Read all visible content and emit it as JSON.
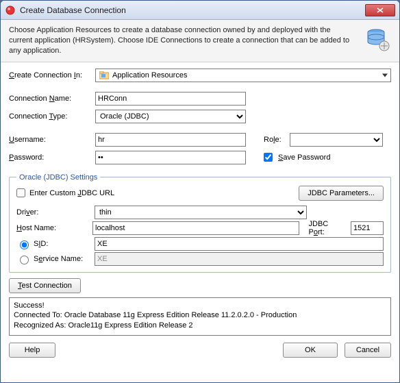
{
  "window": {
    "title": "Create Database Connection"
  },
  "description": "Choose Application Resources to create a database connection owned by and deployed with the current application (HRSystem). Choose IDE Connections to create a connection that can be added to any application.",
  "create_in": {
    "label": "Create Connection In:",
    "value": "Application Resources"
  },
  "connection": {
    "name_label": "Connection Name:",
    "name_value": "HRConn",
    "type_label": "Connection Type:",
    "type_value": "Oracle (JDBC)",
    "username_label": "Username:",
    "username_value": "hr",
    "password_label": "Password:",
    "password_value": "••",
    "role_label": "Role:",
    "role_value": "",
    "save_pw_label": "Save Password",
    "save_pw_checked": true
  },
  "jdbc": {
    "legend": "Oracle (JDBC) Settings",
    "custom_url_label": "Enter Custom JDBC URL",
    "custom_url_checked": false,
    "params_btn": "JDBC Parameters...",
    "driver_label": "Driver:",
    "driver_value": "thin",
    "host_label": "Host Name:",
    "host_value": "localhost",
    "port_label": "JDBC Port:",
    "port_value": "1521",
    "sid_label": "SID:",
    "sid_value": "XE",
    "service_label": "Service Name:",
    "service_value": "XE",
    "sid_selected": true
  },
  "test": {
    "btn": "Test Connection",
    "output_line1": "Success!",
    "output_line2": "Connected To: Oracle Database 11g Express Edition Release 11.2.0.2.0 - Production",
    "output_line3": "Recognized As: Oracle11g Express Edition Release 2"
  },
  "footer": {
    "help": "Help",
    "ok": "OK",
    "cancel": "Cancel"
  }
}
